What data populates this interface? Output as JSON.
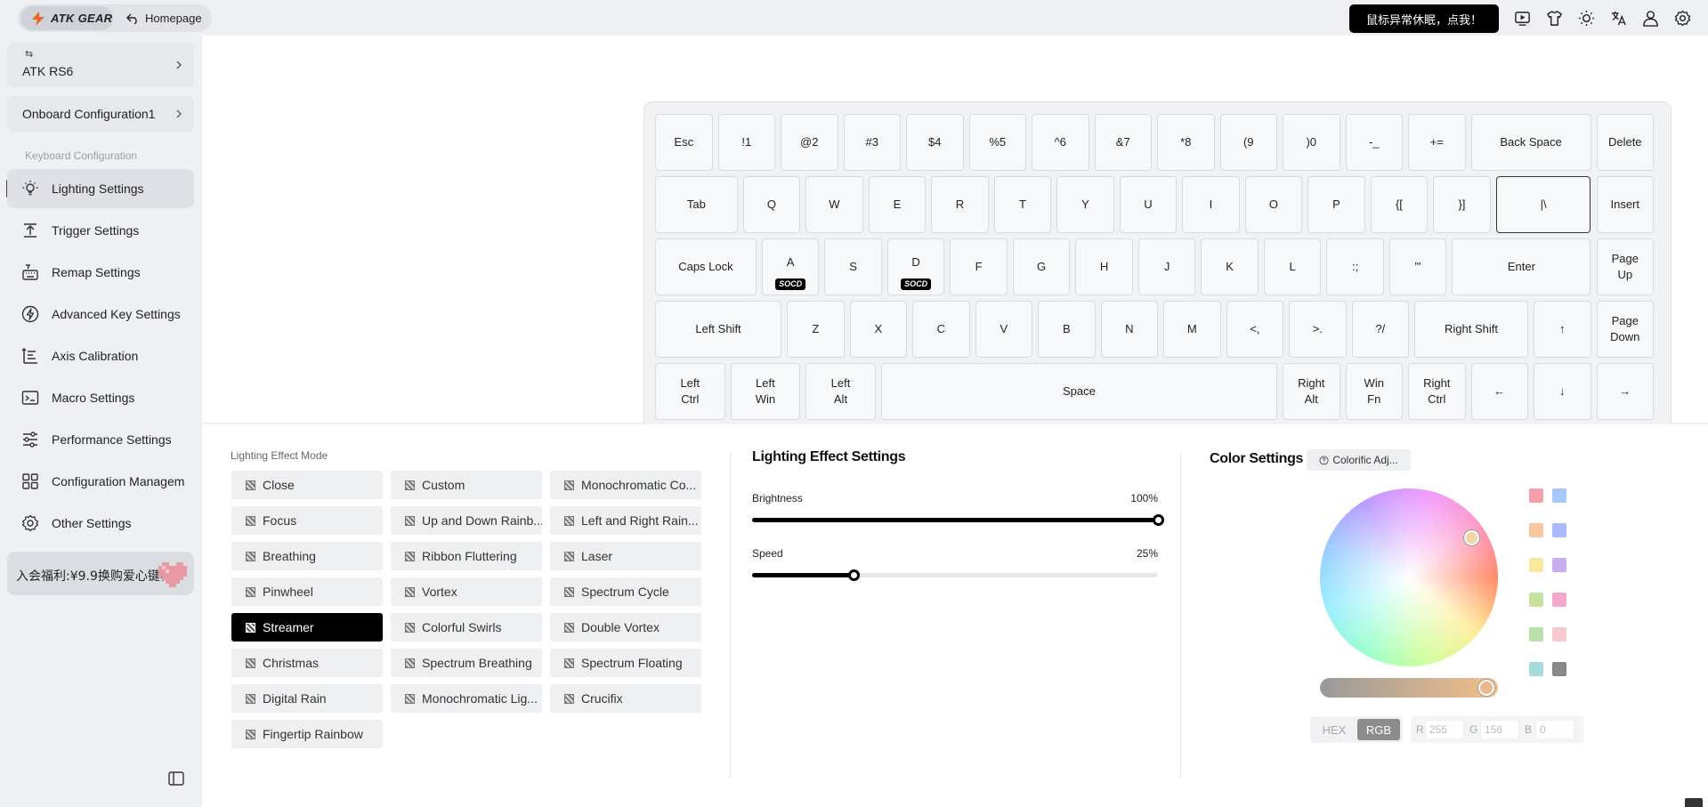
{
  "topbar": {
    "logo_text": "ATK GEAR",
    "home_label": "Homepage",
    "alert_label": "鼠标异常休眠，点我！",
    "icons": [
      "video-icon",
      "shirt-icon",
      "sun-icon",
      "translate-icon",
      "user-icon",
      "settings-icon"
    ]
  },
  "sidebar": {
    "device_name": "ATK RS6",
    "config_name": "Onboard Configuration1",
    "section_label": "Keyboard Configuration",
    "items": [
      {
        "label": "Lighting Settings",
        "icon": "bulb-icon",
        "active": true
      },
      {
        "label": "Trigger Settings",
        "icon": "trigger-icon"
      },
      {
        "label": "Remap Settings",
        "icon": "remap-icon"
      },
      {
        "label": "Advanced Key Settings",
        "icon": "lightning-icon"
      },
      {
        "label": "Axis Calibration",
        "icon": "calibration-icon"
      },
      {
        "label": "Macro Settings",
        "icon": "terminal-icon"
      },
      {
        "label": "Performance Settings",
        "icon": "sliders-icon"
      },
      {
        "label": "Configuration Managem",
        "icon": "grid-icon"
      },
      {
        "label": "Other Settings",
        "icon": "gear-icon"
      }
    ],
    "promo_text": "入会福利:¥9.9换购爱心键帽"
  },
  "keyboard": {
    "socd_label": "SOCD",
    "rows": [
      [
        {
          "l": [
            "Esc"
          ]
        },
        {
          "l": [
            "!1"
          ]
        },
        {
          "l": [
            "@2"
          ]
        },
        {
          "l": [
            "#3"
          ]
        },
        {
          "l": [
            "$4"
          ]
        },
        {
          "l": [
            "%5"
          ]
        },
        {
          "l": [
            "^6"
          ]
        },
        {
          "l": [
            "&7"
          ]
        },
        {
          "l": [
            "*8"
          ]
        },
        {
          "l": [
            "(9"
          ]
        },
        {
          "l": [
            ")0"
          ]
        },
        {
          "l": [
            "-_"
          ]
        },
        {
          "l": [
            "+="
          ]
        },
        {
          "l": [
            "Back Space"
          ]
        },
        {
          "l": [
            "Delete"
          ]
        }
      ],
      [
        {
          "l": [
            "Tab"
          ]
        },
        {
          "l": [
            "Q"
          ]
        },
        {
          "l": [
            "W"
          ]
        },
        {
          "l": [
            "E"
          ]
        },
        {
          "l": [
            "R"
          ]
        },
        {
          "l": [
            "T"
          ]
        },
        {
          "l": [
            "Y"
          ]
        },
        {
          "l": [
            "U"
          ]
        },
        {
          "l": [
            "I"
          ]
        },
        {
          "l": [
            "O"
          ]
        },
        {
          "l": [
            "P"
          ]
        },
        {
          "l": [
            "{["
          ]
        },
        {
          "l": [
            "}]"
          ]
        },
        {
          "l": [
            "|\\"
          ],
          "selected": true
        },
        {
          "l": [
            "Insert"
          ]
        }
      ],
      [
        {
          "l": [
            "Caps Lock"
          ]
        },
        {
          "l": [
            "A"
          ],
          "socd": true
        },
        {
          "l": [
            "S"
          ]
        },
        {
          "l": [
            "D"
          ],
          "socd": true
        },
        {
          "l": [
            "F"
          ]
        },
        {
          "l": [
            "G"
          ]
        },
        {
          "l": [
            "H"
          ]
        },
        {
          "l": [
            "J"
          ]
        },
        {
          "l": [
            "K"
          ]
        },
        {
          "l": [
            "L"
          ]
        },
        {
          "l": [
            ":;"
          ]
        },
        {
          "l": [
            "\"'"
          ]
        },
        {
          "l": [
            "Enter"
          ]
        },
        {
          "l": [
            "Page",
            "Up"
          ]
        }
      ],
      [
        {
          "l": [
            "Left Shift"
          ]
        },
        {
          "l": [
            "Z"
          ]
        },
        {
          "l": [
            "X"
          ]
        },
        {
          "l": [
            "C"
          ]
        },
        {
          "l": [
            "V"
          ]
        },
        {
          "l": [
            "B"
          ]
        },
        {
          "l": [
            "N"
          ]
        },
        {
          "l": [
            "M"
          ]
        },
        {
          "l": [
            "<,"
          ]
        },
        {
          "l": [
            ">."
          ]
        },
        {
          "l": [
            "?/"
          ]
        },
        {
          "l": [
            "Right Shift"
          ]
        },
        {
          "l": [
            "↑"
          ]
        },
        {
          "l": [
            "Page",
            "Down"
          ]
        }
      ],
      [
        {
          "l": [
            "Left",
            "Ctrl"
          ]
        },
        {
          "l": [
            "Left",
            "Win"
          ]
        },
        {
          "l": [
            "Left",
            "Alt"
          ]
        },
        {
          "l": [
            "Space"
          ]
        },
        {
          "l": [
            "Right",
            "Alt"
          ]
        },
        {
          "l": [
            "Win",
            "Fn"
          ]
        },
        {
          "l": [
            "Right",
            "Ctrl"
          ]
        },
        {
          "l": [
            "←"
          ]
        },
        {
          "l": [
            "↓"
          ]
        },
        {
          "l": [
            "→"
          ]
        }
      ]
    ]
  },
  "effects": {
    "label": "Lighting Effect Mode",
    "selected": "Streamer",
    "items": [
      "Close",
      "Custom",
      "Monochromatic Co...",
      "Focus",
      "Up and Down Rainb...",
      "Left and Right Rain...",
      "Breathing",
      "Ribbon Fluttering",
      "Laser",
      "Pinwheel",
      "Vortex",
      "Spectrum Cycle",
      "Streamer",
      "Colorful Swirls",
      "Double Vortex",
      "Christmas",
      "Spectrum Breathing",
      "Spectrum Floating",
      "Digital Rain",
      "Monochromatic Lig...",
      "Crucifix",
      "Fingertip Rainbow"
    ]
  },
  "lighting_settings": {
    "title": "Lighting Effect Settings",
    "brightness": {
      "label": "Brightness",
      "value": 100,
      "display": "100%"
    },
    "speed": {
      "label": "Speed",
      "value": 25,
      "display": "25%"
    }
  },
  "color_settings": {
    "title": "Color Settings",
    "colorific_label": "Colorific Adj...",
    "mode_options": [
      "HEX",
      "RGB"
    ],
    "mode_selected": "RGB",
    "rgb": {
      "r_label": "R",
      "g_label": "G",
      "b_label": "B",
      "r": "255",
      "g": "156",
      "b": "0"
    },
    "swatches": [
      "#f4a0a8",
      "#a8c8fb",
      "#f8c8a0",
      "#aab8f8",
      "#f8e8a0",
      "#c8b0f0",
      "#c8e0a0",
      "#f4a8d0",
      "#b8e0a8",
      "#f8c8d0",
      "#a8dcdc",
      "#8a8a8a"
    ]
  }
}
